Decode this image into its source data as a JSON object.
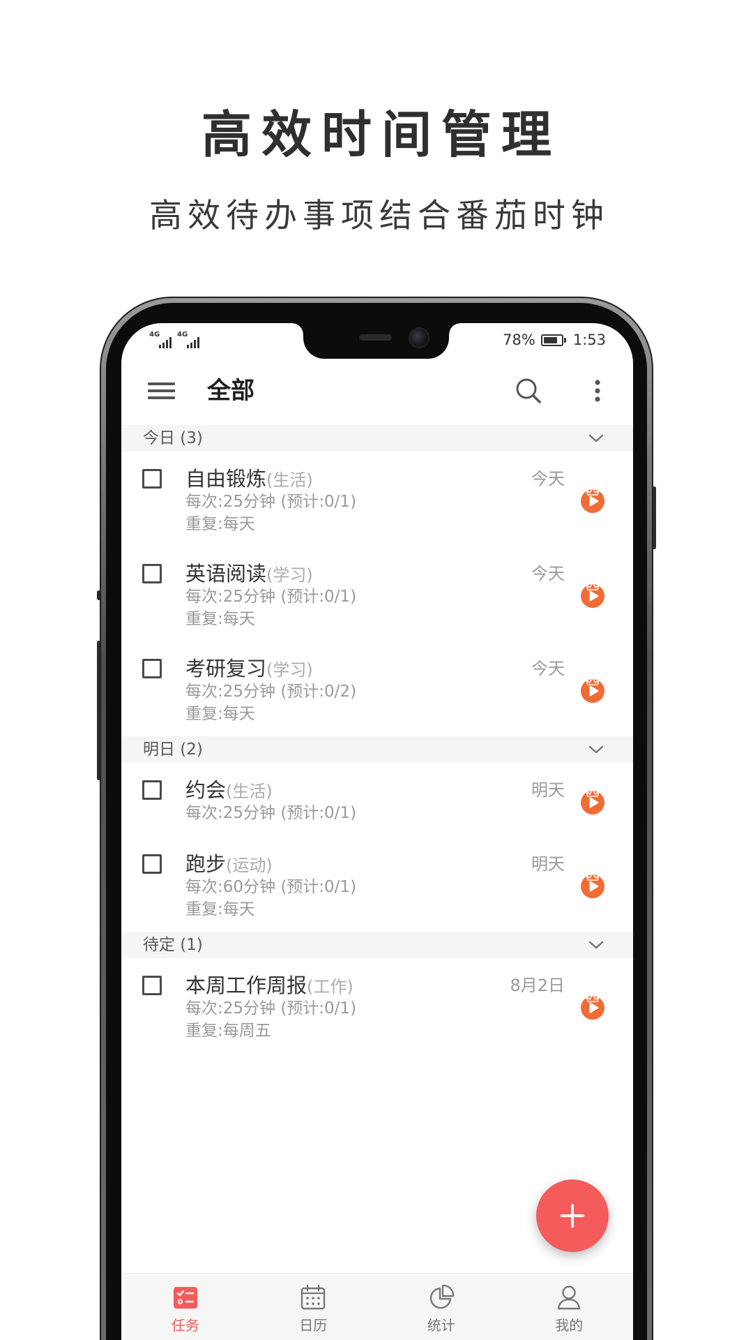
{
  "promo": {
    "title": "高效时间管理",
    "subtitle": "高效待办事项结合番茄时钟"
  },
  "status_bar": {
    "signal_1": {
      "label": "4G",
      "icon": "signal-icon"
    },
    "signal_2": {
      "label": "4G",
      "icon": "signal-icon"
    },
    "battery_text": "78%",
    "battery_level": 0.78,
    "battery_icon": "battery-icon",
    "time": "1:53"
  },
  "app_bar": {
    "title": "全部",
    "menu_icon": "menu-icon",
    "search_icon": "search-icon",
    "more_icon": "more-vert-icon"
  },
  "sections": [
    {
      "header": "今日 (3)",
      "expand_icon": "chevron-down-icon",
      "items": [
        {
          "title": "自由锻炼",
          "category": "(生活)",
          "detail": "每次:25分钟 (预计:0/1)",
          "repeat": "重复:每天",
          "due": "今天",
          "checked": false,
          "action_icon": "tomato-play-icon"
        },
        {
          "title": "英语阅读",
          "category": "(学习)",
          "detail": "每次:25分钟 (预计:0/1)",
          "repeat": "重复:每天",
          "due": "今天",
          "checked": false,
          "action_icon": "tomato-play-icon"
        },
        {
          "title": "考研复习",
          "category": "(学习)",
          "detail": "每次:25分钟 (预计:0/2)",
          "repeat": "重复:每天",
          "due": "今天",
          "checked": false,
          "action_icon": "tomato-play-icon"
        }
      ]
    },
    {
      "header": "明日 (2)",
      "expand_icon": "chevron-down-icon",
      "items": [
        {
          "title": "约会",
          "category": "(生活)",
          "detail": "每次:25分钟 (预计:0/1)",
          "due": "明天",
          "checked": false,
          "action_icon": "tomato-play-icon"
        },
        {
          "title": "跑步",
          "category": "(运动)",
          "detail": "每次:60分钟 (预计:0/1)",
          "repeat": "重复:每天",
          "due": "明天",
          "checked": false,
          "action_icon": "tomato-play-icon"
        }
      ]
    },
    {
      "header": "待定 (1)",
      "expand_icon": "chevron-down-icon",
      "items": [
        {
          "title": "本周工作周报",
          "category": "(工作)",
          "detail": "每次:25分钟 (预计:0/1)",
          "repeat": "重复:每周五",
          "due": "8月2日",
          "checked": false,
          "action_icon": "tomato-play-icon"
        }
      ]
    }
  ],
  "fab": {
    "icon": "plus-icon"
  },
  "bottom_nav": [
    {
      "label": "任务",
      "icon": "tasks-icon",
      "active": true
    },
    {
      "label": "日历",
      "icon": "calendar-icon",
      "active": false
    },
    {
      "label": "统计",
      "icon": "pie-chart-icon",
      "active": false
    },
    {
      "label": "我的",
      "icon": "profile-icon",
      "active": false
    }
  ],
  "colors": {
    "accent": "#f45b5b",
    "tomato": "#f26b35",
    "section_bg": "#f5f5f5",
    "text_primary": "#333333",
    "text_secondary": "#9a9a9a"
  }
}
